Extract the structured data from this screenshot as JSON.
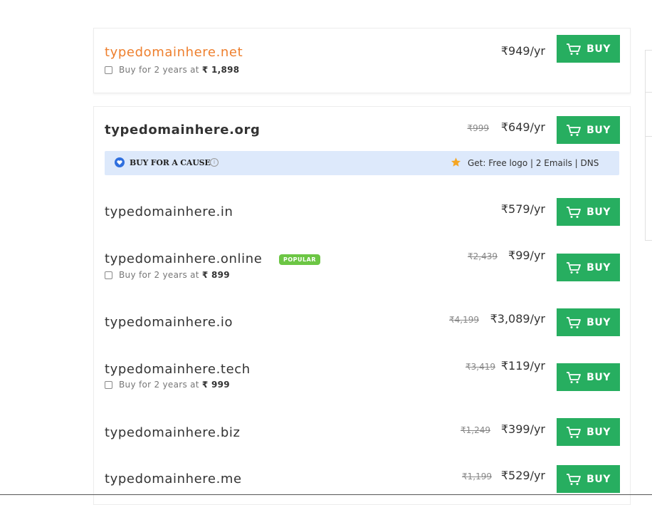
{
  "currency_symbol": "₹",
  "buy_label": "BUY",
  "featured": {
    "domain": "typedomainhere.net",
    "price": "₹949/yr",
    "two_year_text": "Buy for 2 years at",
    "two_year_amount": "₹ 1,898"
  },
  "cause_banner": {
    "label": "BUY FOR A CAUSE",
    "perks": "Get: Free logo | 2 Emails | DNS"
  },
  "results": [
    {
      "domain": "typedomainhere.org",
      "old_price": "₹999",
      "price": "₹649/yr"
    },
    {
      "domain": "typedomainhere.in",
      "old_price": "",
      "price": "₹579/yr"
    },
    {
      "domain": "typedomainhere.online",
      "badge": "POPULAR",
      "old_price": "₹2,439",
      "price": "₹99/yr",
      "two_year_text": "Buy for 2 years at",
      "two_year_amount": "₹ 899"
    },
    {
      "domain": "typedomainhere.io",
      "old_price": "₹4,199",
      "price": "₹3,089/yr"
    },
    {
      "domain": "typedomainhere.tech",
      "old_price": "₹3,419",
      "price": "₹119/yr",
      "two_year_text": "Buy for 2 years at",
      "two_year_amount": "₹ 999"
    },
    {
      "domain": "typedomainhere.biz",
      "old_price": "₹1,249",
      "price": "₹399/yr"
    },
    {
      "domain": "typedomainhere.me",
      "old_price": "₹1,199",
      "price": "₹529/yr"
    }
  ],
  "colors": {
    "buy_button": "#27ae60",
    "featured_domain": "#ee7f2d",
    "popular_badge": "#6cc644",
    "cause_banner_bg": "#dde9fb"
  }
}
